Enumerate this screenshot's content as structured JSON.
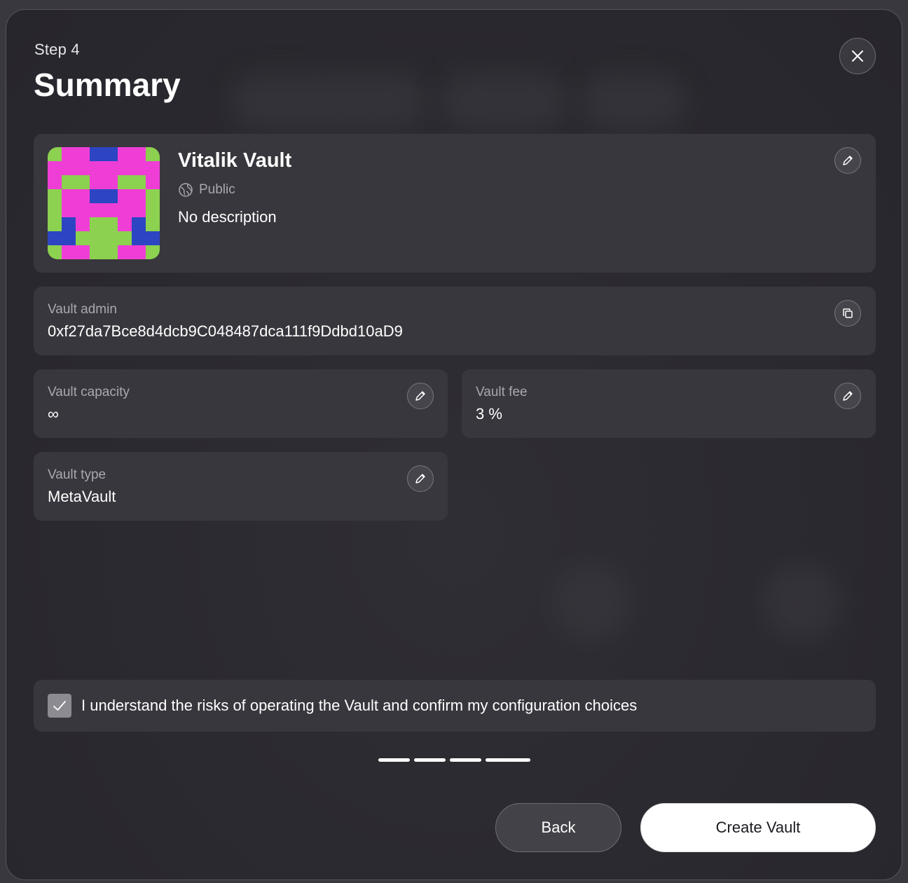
{
  "header": {
    "step": "Step 4",
    "title": "Summary"
  },
  "vault": {
    "name": "Vitalik Vault",
    "visibility": "Public",
    "description": "No description"
  },
  "admin": {
    "label": "Vault admin",
    "value": "0xf27da7Bce8d4dcb9C048487dca111f9Ddbd10aD9"
  },
  "capacity": {
    "label": "Vault capacity",
    "value": "∞"
  },
  "fee": {
    "label": "Vault fee",
    "value": "3 %"
  },
  "type": {
    "label": "Vault type",
    "value": "MetaVault"
  },
  "confirm": {
    "text": "I understand the risks of operating the Vault and confirm my configuration choices",
    "checked": true
  },
  "progress": {
    "total_steps": 4,
    "current_step": 4
  },
  "buttons": {
    "back": "Back",
    "create": "Create Vault"
  },
  "icons": {
    "close": "close-icon",
    "edit": "pencil-icon",
    "copy": "copy-icon",
    "globe": "globe-icon",
    "check": "check-icon"
  },
  "colors": {
    "avatar_pink": "#ef3ed6",
    "avatar_green": "#8cd14f",
    "avatar_blue": "#2d45c2",
    "primary_button": "#ffffff"
  }
}
